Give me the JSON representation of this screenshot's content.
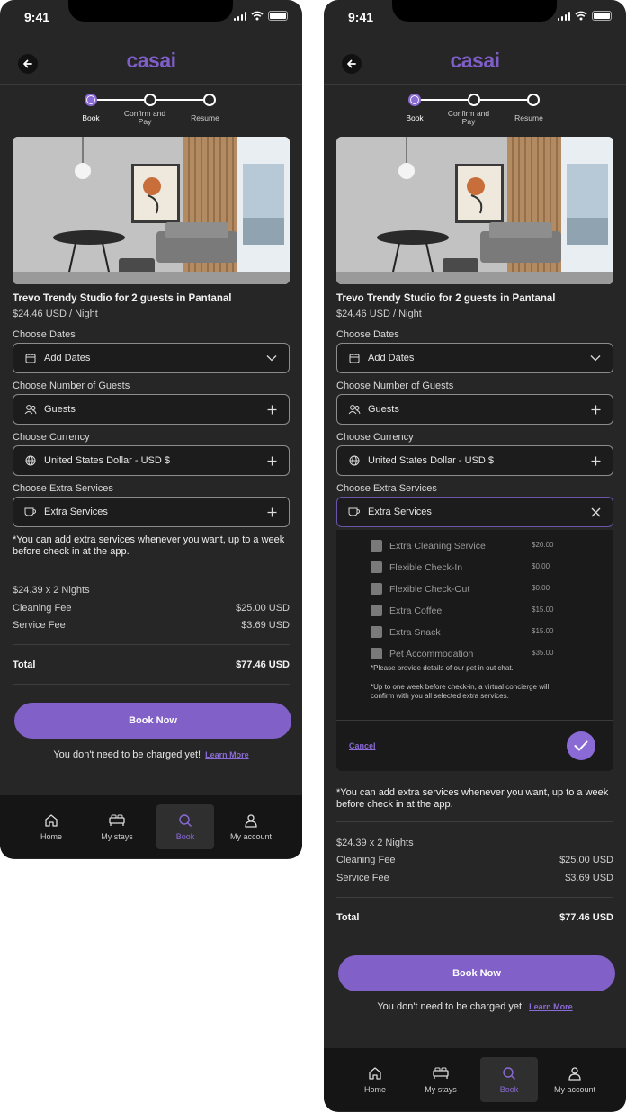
{
  "status": {
    "time": "9:41"
  },
  "brand": {
    "logo": "casai",
    "accent": "#8160c8"
  },
  "stepper": {
    "steps": [
      {
        "label": "Book",
        "active": true
      },
      {
        "label": "Confirm and Pay",
        "active": false
      },
      {
        "label": "Resume",
        "active": false
      }
    ]
  },
  "listing": {
    "title": "Trevo Trendy Studio for 2 guests in Pantanal",
    "price": "$24.46 USD / Night"
  },
  "form": {
    "dates": {
      "label": "Choose Dates",
      "value": "Add Dates",
      "icon": "calendar-icon"
    },
    "guests": {
      "label": "Choose Number of Guests",
      "value": "Guests",
      "icon": "users-icon"
    },
    "currency": {
      "label": "Choose Currency",
      "value": "United States Dollar - USD $",
      "icon": "globe-icon"
    },
    "extras": {
      "label": "Choose Extra Services",
      "value": "Extra Services",
      "icon": "coffee-icon"
    }
  },
  "extras_note": "*You can add extra services whenever you want, up to a week before check in at the app.",
  "dropdown": {
    "options": [
      {
        "label": "Extra Cleaning Service",
        "price": "$20.00"
      },
      {
        "label": "Flexible Check-In",
        "price": "$0.00"
      },
      {
        "label": "Flexible Check-Out",
        "price": "$0.00"
      },
      {
        "label": "Extra Coffee",
        "price": "$15.00"
      },
      {
        "label": "Extra Snack",
        "price": "$15.00"
      },
      {
        "label": "Pet Accommodation",
        "price": "$35.00"
      }
    ],
    "pet_note": "*Please provide details of our pet in out chat.",
    "concierge_note": "*Up to one week before check-in, a virtual concierge will confirm with you all selected extra services.",
    "cancel": "Cancel"
  },
  "summary": {
    "nights": "$24.39 x 2 Nights",
    "cleaning_label": "Cleaning Fee",
    "cleaning_value": "$25.00 USD",
    "service_label": "Service Fee",
    "service_value": "$3.69 USD",
    "total_label": "Total",
    "total_value": "$77.46 USD"
  },
  "cta": {
    "book": "Book Now",
    "charge_text": "You don't need to be charged yet!",
    "learn_more": "Learn More"
  },
  "tabs": [
    {
      "label": "Home",
      "icon": "home-icon"
    },
    {
      "label": "My stays",
      "icon": "bed-icon"
    },
    {
      "label": "Book",
      "icon": "search-icon",
      "active": true
    },
    {
      "label": "My account",
      "icon": "user-icon"
    }
  ]
}
